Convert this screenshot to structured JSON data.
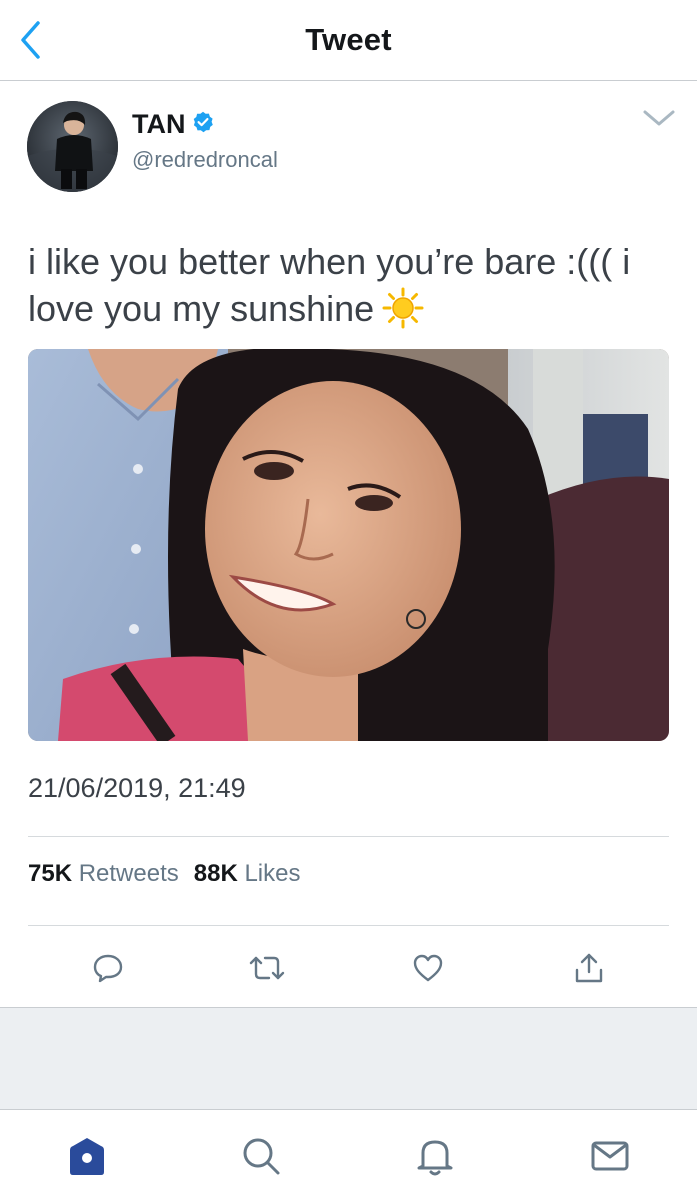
{
  "header": {
    "title": "Tweet",
    "back_icon": "chevron-left-icon"
  },
  "author": {
    "display_name": "TAN",
    "verified": true,
    "handle": "@redredroncal",
    "menu_icon": "chevron-down-icon"
  },
  "tweet": {
    "text": "i like you better when you’re bare :((( i love you my sunshine",
    "emoji": "sun-icon",
    "media": "photo",
    "timestamp": "21/06/2019, 21:49"
  },
  "stats": {
    "retweets_count": "75K",
    "retweets_label": "Retweets",
    "likes_count": "88K",
    "likes_label": "Likes"
  },
  "actions": [
    "reply-icon",
    "retweet-icon",
    "like-icon",
    "share-icon"
  ],
  "tabbar": [
    "home-icon",
    "search-icon",
    "notifications-icon",
    "messages-icon"
  ],
  "colors": {
    "accent": "#1da1f2",
    "home_active": "#2a4b9b",
    "text_primary": "#14171a",
    "text_secondary": "#657786",
    "tweet_text": "#3b4148",
    "icon_grey": "#657786",
    "divider": "#d6dadd",
    "background_grey": "#eceff2"
  }
}
